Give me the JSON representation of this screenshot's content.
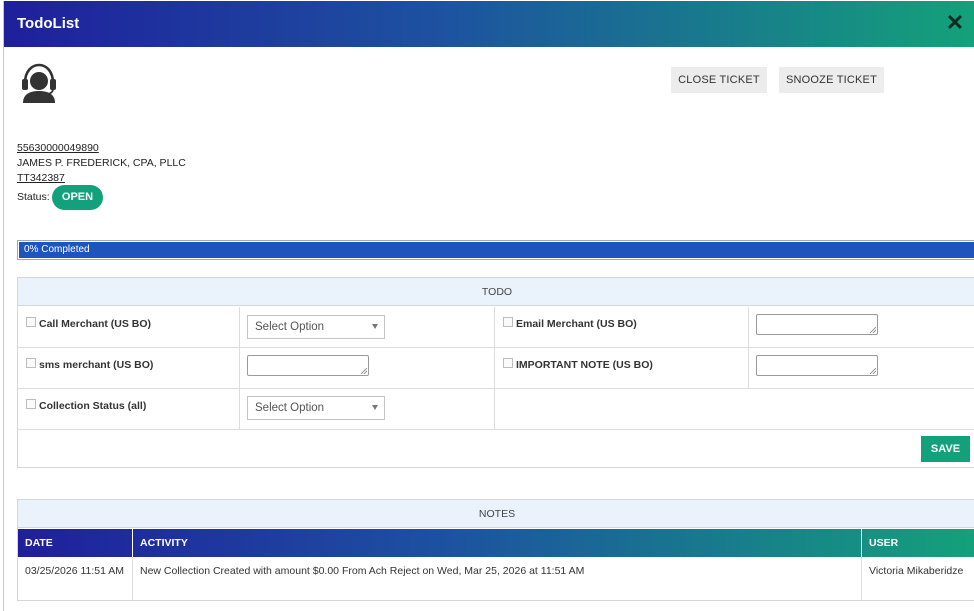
{
  "window": {
    "title": "TodoList",
    "close_glyph": "✕"
  },
  "header": {
    "agent_icon": "support-agent-icon"
  },
  "actions": {
    "close_ticket": "CLOSE TICKET",
    "snooze_ticket": "SNOOZE TICKET"
  },
  "ticket": {
    "account_number": "55630000049890",
    "merchant_name": "JAMES P. FREDERICK, CPA, PLLC",
    "ticket_id": "TT342387",
    "status_label": "Status:",
    "status": "OPEN"
  },
  "progress": {
    "label": "0% Completed",
    "percent": 0
  },
  "todo": {
    "section_title": "TODO",
    "items": [
      {
        "label": "Call Merchant (US BO)",
        "control": "select",
        "value": "Select Option"
      },
      {
        "label": "Email Merchant (US BO)",
        "control": "textarea",
        "value": ""
      },
      {
        "label": "sms merchant (US BO)",
        "control": "textarea",
        "value": ""
      },
      {
        "label": "IMPORTANT NOTE (US BO)",
        "control": "textarea",
        "value": ""
      },
      {
        "label": "Collection Status (all)",
        "control": "select",
        "value": "Select Option"
      }
    ],
    "save_label": "SAVE"
  },
  "notes": {
    "section_title": "NOTES",
    "columns": [
      "DATE",
      "ACTIVITY",
      "USER"
    ],
    "rows": [
      {
        "date": "03/25/2026 11:51 AM",
        "activity": "New Collection Created with amount $0.00 From Ach Reject on Wed, Mar 25, 2026 at 11:51 AM",
        "user": "Victoria Mikaberidze"
      }
    ]
  },
  "colors": {
    "gradient_start": "#1f1f9c",
    "gradient_mid": "#1d52a0",
    "gradient_end": "#14a17a",
    "accent_green": "#13a17c",
    "progress_blue": "#1e55bd"
  }
}
